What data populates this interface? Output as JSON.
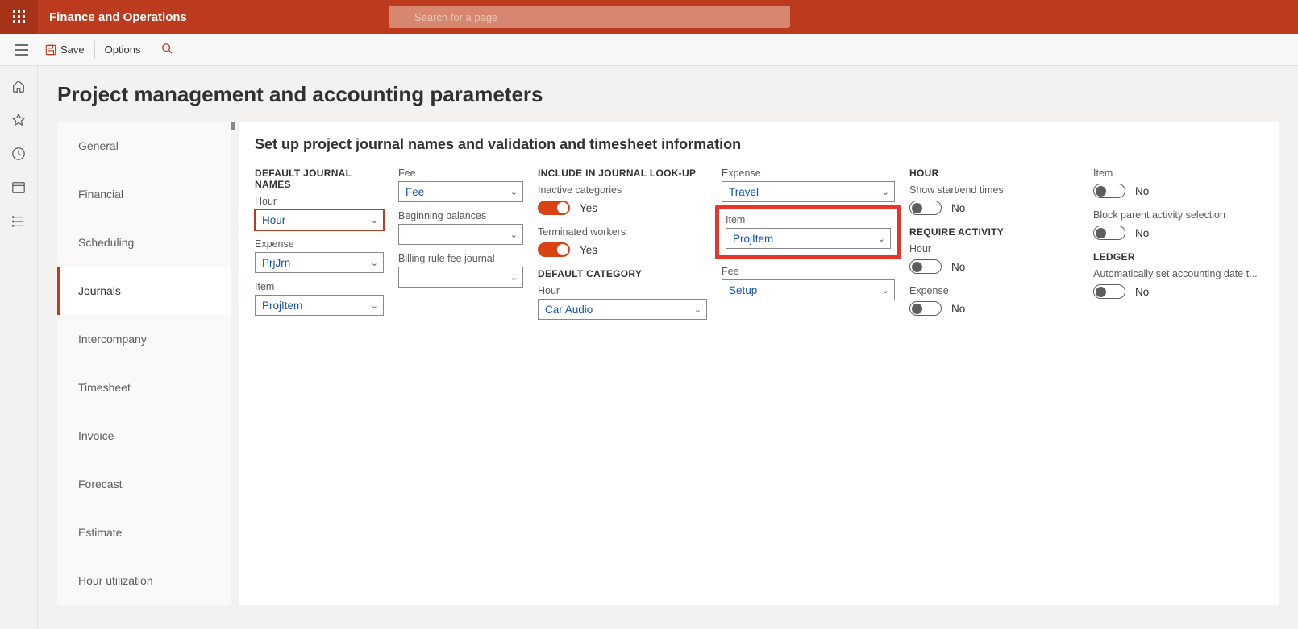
{
  "header": {
    "app_title": "Finance and Operations",
    "search_placeholder": "Search for a page"
  },
  "actionbar": {
    "save": "Save",
    "options": "Options"
  },
  "page_title": "Project management and accounting parameters",
  "sidebar": {
    "items": [
      {
        "label": "General"
      },
      {
        "label": "Financial"
      },
      {
        "label": "Scheduling"
      },
      {
        "label": "Journals"
      },
      {
        "label": "Intercompany"
      },
      {
        "label": "Timesheet"
      },
      {
        "label": "Invoice"
      },
      {
        "label": "Forecast"
      },
      {
        "label": "Estimate"
      },
      {
        "label": "Hour utilization"
      }
    ],
    "selected_index": 3
  },
  "main": {
    "section_title": "Set up project journal names and validation and timesheet information",
    "default_journal_names": {
      "heading": "DEFAULT JOURNAL NAMES",
      "hour": {
        "label": "Hour",
        "value": "Hour"
      },
      "expense": {
        "label": "Expense",
        "value": "PrjJrn"
      },
      "item": {
        "label": "Item",
        "value": "ProjItem"
      },
      "fee": {
        "label": "Fee",
        "value": "Fee"
      },
      "beginning_balances": {
        "label": "Beginning balances",
        "value": ""
      },
      "billing_rule_fee": {
        "label": "Billing rule fee journal",
        "value": ""
      }
    },
    "include_lookup": {
      "heading": "INCLUDE IN JOURNAL LOOK-UP",
      "inactive": {
        "label": "Inactive categories",
        "value": "Yes",
        "on": true
      },
      "terminated": {
        "label": "Terminated workers",
        "value": "Yes",
        "on": true
      }
    },
    "default_category": {
      "heading": "DEFAULT CATEGORY",
      "hour": {
        "label": "Hour",
        "value": "Car Audio"
      },
      "expense": {
        "label": "Expense",
        "value": "Travel"
      },
      "item": {
        "label": "Item",
        "value": "ProjItem"
      },
      "fee": {
        "label": "Fee",
        "value": "Setup"
      }
    },
    "hour_group": {
      "heading": "HOUR",
      "show_times": {
        "label": "Show start/end times",
        "value": "No",
        "on": false
      }
    },
    "require_activity": {
      "heading": "REQUIRE ACTIVITY",
      "hour": {
        "label": "Hour",
        "value": "No",
        "on": false
      },
      "expense": {
        "label": "Expense",
        "value": "No",
        "on": false
      },
      "item": {
        "label": "Item",
        "value": "No",
        "on": false
      },
      "block_parent": {
        "label": "Block parent activity selection",
        "value": "No",
        "on": false
      }
    },
    "ledger": {
      "heading": "LEDGER",
      "auto_date": {
        "label": "Automatically set accounting date t...",
        "value": "No",
        "on": false
      }
    }
  }
}
